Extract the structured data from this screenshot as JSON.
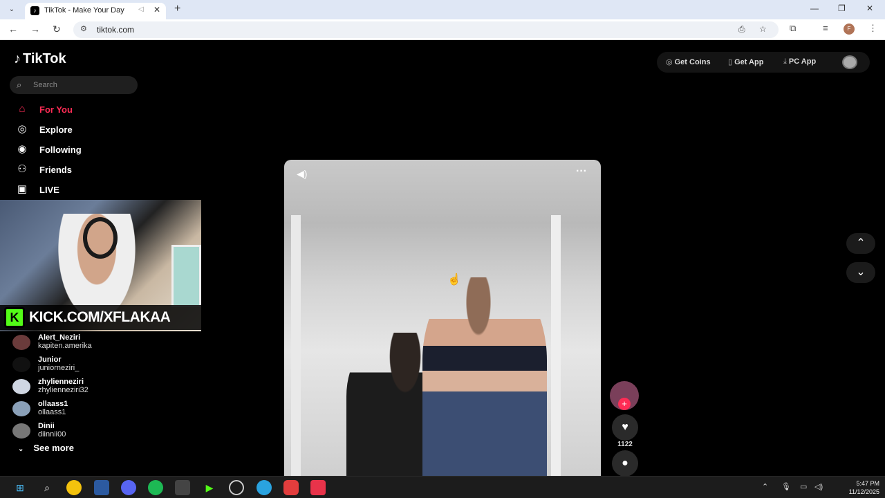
{
  "browser": {
    "tab": {
      "title": "TikTok - Make Your Day"
    },
    "url": "tiktok.com",
    "profile_initial": "F"
  },
  "tiktok": {
    "logo": "TikTok",
    "search_placeholder": "Search",
    "nav": [
      {
        "label": "For You",
        "icon": "home-icon",
        "active": true
      },
      {
        "label": "Explore",
        "icon": "compass-icon"
      },
      {
        "label": "Following",
        "icon": "following-icon"
      },
      {
        "label": "Friends",
        "icon": "friends-icon"
      },
      {
        "label": "LIVE",
        "icon": "live-icon"
      }
    ],
    "following_accounts": [
      {
        "name": "Alert_Neziri",
        "handle": "kapiten.amerika"
      },
      {
        "name": "Junior",
        "handle": "juniorneziri_"
      },
      {
        "name": "zhylienneziri",
        "handle": "zhylienneziri32"
      },
      {
        "name": "ollaass1",
        "handle": "ollaass1"
      },
      {
        "name": "Dinii",
        "handle": "diinnii00"
      }
    ],
    "see_more": "See more",
    "top_buttons": {
      "get_coins": "Get Coins",
      "get_app": "Get App",
      "pc_app": "PC App"
    },
    "video": {
      "like_count": "1122"
    }
  },
  "stream_overlay": {
    "kick_text": "KICK.COM/XFLAKAA",
    "kick_logo": "K"
  },
  "taskbar": {
    "time": "5:47 PM",
    "date": "11/12/2025",
    "accent_colors": {
      "tiktok_red": "#fe2c55",
      "kick_green": "#53fc18"
    }
  }
}
